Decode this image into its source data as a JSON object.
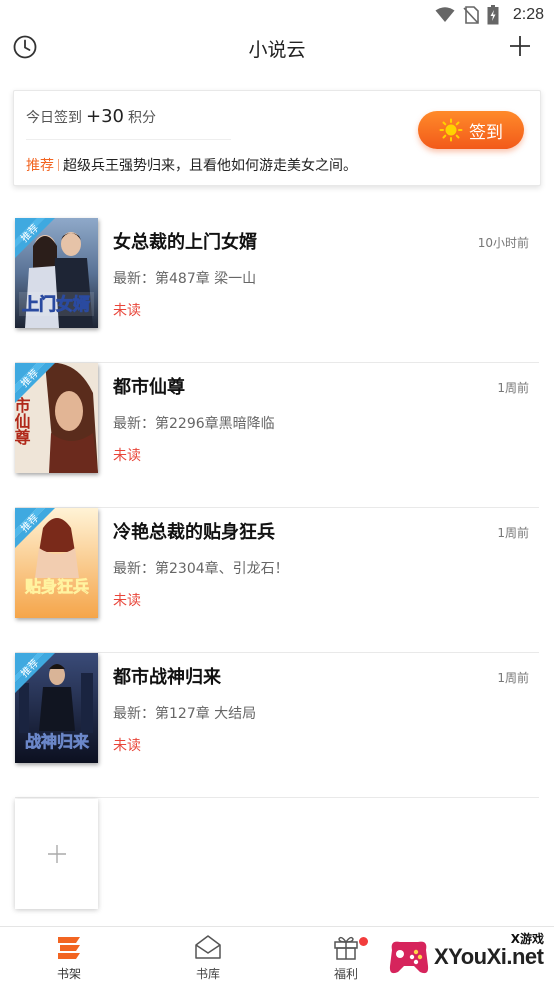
{
  "status_bar": {
    "time": "2:28"
  },
  "header": {
    "title": "小说云"
  },
  "signin": {
    "prefix": "今日签到",
    "points": "+30",
    "suffix": "积分",
    "button_label": "签到",
    "recommend_tag": "推荐",
    "recommend_text": "超级兵王强势归来，且看他如何游走美女之间。"
  },
  "books": [
    {
      "title": "女总裁的上门女婿",
      "latest": "最新：第487章 梁一山",
      "status": "未读",
      "updated": "10小时前",
      "ribbon": "推荐",
      "cover_text": "上门女婿"
    },
    {
      "title": "都市仙尊",
      "latest": "最新：第2296章黑暗降临",
      "status": "未读",
      "updated": "1周前",
      "ribbon": "推荐",
      "cover_text": "市仙尊"
    },
    {
      "title": "冷艳总裁的贴身狂兵",
      "latest": "最新：第2304章、引龙石！",
      "status": "未读",
      "updated": "1周前",
      "ribbon": "推荐",
      "cover_text": "贴身狂兵"
    },
    {
      "title": "都市战神归来",
      "latest": "最新：第127章 大结局",
      "status": "未读",
      "updated": "1周前",
      "ribbon": "推荐",
      "cover_text": "战神归来"
    }
  ],
  "bottom_nav": [
    {
      "label": "书架",
      "icon": "bookshelf-icon",
      "active": true
    },
    {
      "label": "书库",
      "icon": "library-icon",
      "active": false
    },
    {
      "label": "福利",
      "icon": "gift-icon",
      "active": false
    }
  ],
  "watermark": {
    "top_text": "X游戏",
    "main_text": "XYouXi.net"
  },
  "colors": {
    "accent": "#f26522",
    "unread": "#e8463a",
    "badge": "#f23c3c"
  }
}
